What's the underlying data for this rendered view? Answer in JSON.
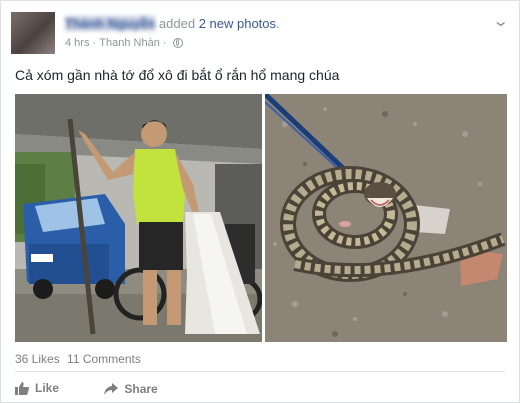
{
  "post": {
    "author_name": "Thành Nguyễn",
    "action_prefix": "added",
    "action_link": "2 new photos",
    "action_suffix": ".",
    "time": "4 hrs",
    "separator": "·",
    "location": "Thanh Nhàn",
    "separator2": "·",
    "privacy_icon": "globe-icon",
    "caption": "Cả xóm gần nhà tớ đổ xô đi bắt ổ rắn hổ mang chúa"
  },
  "photos": [
    {
      "name": "photo-man-with-snake-sack"
    },
    {
      "name": "photo-coiled-cobra"
    }
  ],
  "stats": {
    "likes": "36 Likes",
    "comments": "11 Comments"
  },
  "actions": {
    "like_label": "Like",
    "share_label": "Share"
  },
  "colors": {
    "link": "#365899",
    "meta": "#90949c",
    "text": "#1d2129"
  }
}
